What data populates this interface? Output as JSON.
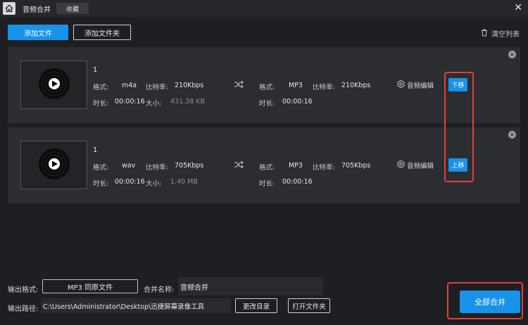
{
  "titlebar": {
    "app_title": "音频合并",
    "fav_label": "收藏",
    "close_glyph": "✕"
  },
  "toolbar": {
    "add_file": "添加文件",
    "add_folder": "添加文件夹",
    "clear_list": "清空列表"
  },
  "labels": {
    "format": "格式:",
    "bitrate": "比特率:",
    "duration": "时长:",
    "size": "大小:",
    "edit_audio": "音频编辑"
  },
  "files": [
    {
      "name": "1",
      "src_format": "m4a",
      "src_bitrate": "210Kbps",
      "duration": "00:00:16",
      "size": "431.38 KB",
      "out_format": "MP3",
      "out_bitrate": "210Kbps",
      "out_duration": "00:00:16",
      "move_label": "下移"
    },
    {
      "name": "1",
      "src_format": "wav",
      "src_bitrate": "705Kbps",
      "duration": "00:00:16",
      "size": "1.40 MB",
      "out_format": "MP3",
      "out_bitrate": "705Kbps",
      "out_duration": "00:00:16",
      "move_label": "上移"
    }
  ],
  "bottom": {
    "output_format_label": "输出格式:",
    "output_format_value": "MP3 同原文件",
    "merge_name_label": "合并名称:",
    "merge_name_value": "音频合并",
    "output_path_label": "输出路径:",
    "output_path_value": "C:\\Users\\Administrator\\Desktop\\迅捷屏幕录像工具",
    "change_dir": "更改目录",
    "open_folder": "打开文件夹",
    "merge_all": "全部合并"
  },
  "colors": {
    "accent": "#1893ea",
    "highlight": "#e0413a",
    "background": "#1e1f23",
    "row_background": "#2c2d31"
  },
  "icons": [
    "home-icon",
    "close-icon",
    "trash-icon",
    "music-disc-icon",
    "shuffle-icon",
    "settings-icon"
  ]
}
